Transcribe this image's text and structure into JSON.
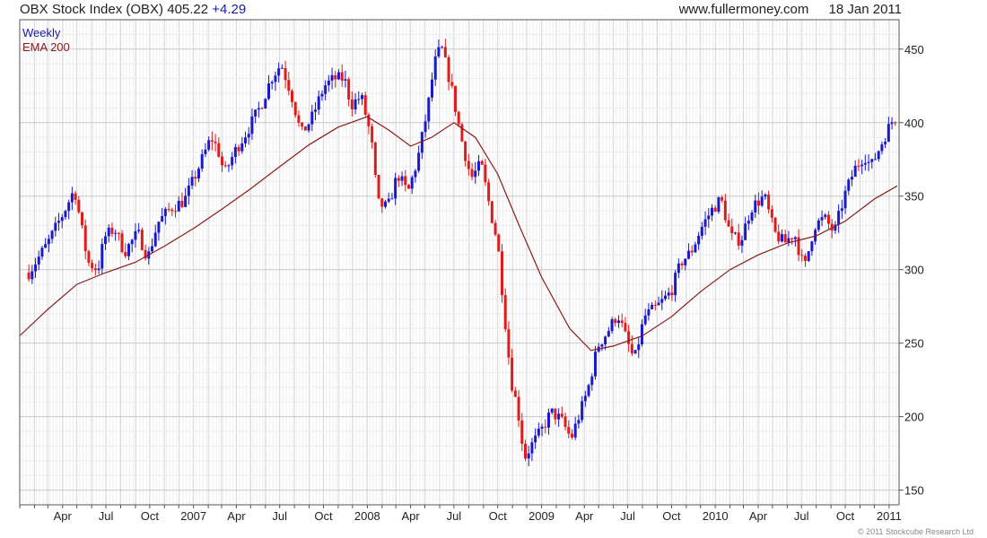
{
  "header": {
    "title": "OBX Stock Index (OBX) 405.22",
    "change": "+4.29",
    "site": "www.fullermoney.com",
    "date": "18 Jan 2011"
  },
  "legend": {
    "weekly": "Weekly",
    "ema": "EMA 200"
  },
  "copyright": "© 2011 Stockcube Research Ltd",
  "colors": {
    "up": "#1a1acc",
    "down": "#e01b1b",
    "ema": "#8b1a1a",
    "grid": "#d7d7d7",
    "axis": "#555555",
    "background": "#ffffff"
  },
  "chart_data": {
    "type": "candlestick-weekly",
    "ylim": [
      140,
      470
    ],
    "y_ticks": [
      150,
      200,
      250,
      300,
      350,
      400,
      450
    ],
    "x_ticks": [
      {
        "label": "Apr",
        "date": "2006-04-01"
      },
      {
        "label": "Jul",
        "date": "2006-07-01"
      },
      {
        "label": "Oct",
        "date": "2006-10-01"
      },
      {
        "label": "2007",
        "date": "2007-01-01"
      },
      {
        "label": "Apr",
        "date": "2007-04-01"
      },
      {
        "label": "Jul",
        "date": "2007-07-01"
      },
      {
        "label": "Oct",
        "date": "2007-10-01"
      },
      {
        "label": "2008",
        "date": "2008-01-01"
      },
      {
        "label": "Apr",
        "date": "2008-04-01"
      },
      {
        "label": "Jul",
        "date": "2008-07-01"
      },
      {
        "label": "Oct",
        "date": "2008-10-01"
      },
      {
        "label": "2009",
        "date": "2009-01-01"
      },
      {
        "label": "Apr",
        "date": "2009-04-01"
      },
      {
        "label": "Jul",
        "date": "2009-07-01"
      },
      {
        "label": "Oct",
        "date": "2009-10-01"
      },
      {
        "label": "2010",
        "date": "2010-01-01"
      },
      {
        "label": "Apr",
        "date": "2010-04-01"
      },
      {
        "label": "Jul",
        "date": "2010-07-01"
      },
      {
        "label": "Oct",
        "date": "2010-10-01"
      },
      {
        "label": "2011",
        "date": "2011-01-01"
      }
    ],
    "series": [
      {
        "name": "Weekly",
        "type": "candlestick",
        "close_keypoints": [
          [
            "2006-01-20",
            298
          ],
          [
            "2006-03-01",
            318
          ],
          [
            "2006-04-05",
            340
          ],
          [
            "2006-04-26",
            355
          ],
          [
            "2006-05-10",
            330
          ],
          [
            "2006-05-24",
            305
          ],
          [
            "2006-06-14",
            300
          ],
          [
            "2006-06-28",
            322
          ],
          [
            "2006-07-19",
            328
          ],
          [
            "2006-08-09",
            312
          ],
          [
            "2006-09-06",
            325
          ],
          [
            "2006-09-27",
            308
          ],
          [
            "2006-10-18",
            332
          ],
          [
            "2006-11-15",
            342
          ],
          [
            "2006-12-13",
            347
          ],
          [
            "2007-01-10",
            368
          ],
          [
            "2007-02-07",
            390
          ],
          [
            "2007-02-21",
            382
          ],
          [
            "2007-03-07",
            365
          ],
          [
            "2007-03-28",
            380
          ],
          [
            "2007-04-25",
            395
          ],
          [
            "2007-05-23",
            412
          ],
          [
            "2007-06-13",
            430
          ],
          [
            "2007-07-04",
            440
          ],
          [
            "2007-07-25",
            420
          ],
          [
            "2007-08-15",
            392
          ],
          [
            "2007-09-05",
            402
          ],
          [
            "2007-10-03",
            425
          ],
          [
            "2007-10-24",
            430
          ],
          [
            "2007-11-14",
            430
          ],
          [
            "2007-11-28",
            412
          ],
          [
            "2007-12-19",
            418
          ],
          [
            "2008-01-09",
            390
          ],
          [
            "2008-01-23",
            345
          ],
          [
            "2008-02-13",
            342
          ],
          [
            "2008-03-05",
            365
          ],
          [
            "2008-03-26",
            352
          ],
          [
            "2008-04-16",
            375
          ],
          [
            "2008-05-07",
            410
          ],
          [
            "2008-05-21",
            440
          ],
          [
            "2008-06-04",
            452
          ],
          [
            "2008-06-25",
            425
          ],
          [
            "2008-07-16",
            390
          ],
          [
            "2008-08-06",
            362
          ],
          [
            "2008-08-27",
            372
          ],
          [
            "2008-09-17",
            338
          ],
          [
            "2008-10-01",
            318
          ],
          [
            "2008-10-15",
            270
          ],
          [
            "2008-10-29",
            225
          ],
          [
            "2008-11-12",
            205
          ],
          [
            "2008-11-26",
            172
          ],
          [
            "2008-12-10",
            180
          ],
          [
            "2008-12-31",
            190
          ],
          [
            "2009-01-21",
            203
          ],
          [
            "2009-02-11",
            198
          ],
          [
            "2009-03-04",
            185
          ],
          [
            "2009-03-18",
            198
          ],
          [
            "2009-04-08",
            218
          ],
          [
            "2009-04-29",
            248
          ],
          [
            "2009-05-20",
            258
          ],
          [
            "2009-06-10",
            270
          ],
          [
            "2009-07-01",
            250
          ],
          [
            "2009-07-15",
            238
          ],
          [
            "2009-08-05",
            268
          ],
          [
            "2009-09-02",
            275
          ],
          [
            "2009-09-30",
            285
          ],
          [
            "2009-10-21",
            305
          ],
          [
            "2009-11-11",
            312
          ],
          [
            "2009-12-02",
            328
          ],
          [
            "2009-12-23",
            340
          ],
          [
            "2010-01-13",
            348
          ],
          [
            "2010-02-03",
            322
          ],
          [
            "2010-02-24",
            320
          ],
          [
            "2010-03-17",
            342
          ],
          [
            "2010-04-14",
            350
          ],
          [
            "2010-05-05",
            325
          ],
          [
            "2010-05-26",
            318
          ],
          [
            "2010-06-16",
            325
          ],
          [
            "2010-07-07",
            300
          ],
          [
            "2010-07-28",
            330
          ],
          [
            "2010-08-18",
            335
          ],
          [
            "2010-09-08",
            325
          ],
          [
            "2010-09-29",
            350
          ],
          [
            "2010-10-20",
            368
          ],
          [
            "2010-11-10",
            378
          ],
          [
            "2010-11-24",
            370
          ],
          [
            "2010-12-15",
            385
          ],
          [
            "2011-01-05",
            400
          ],
          [
            "2011-01-18",
            405
          ]
        ]
      },
      {
        "name": "EMA 200",
        "type": "line",
        "points": [
          [
            "2006-01-01",
            255
          ],
          [
            "2006-03-01",
            273
          ],
          [
            "2006-05-01",
            290
          ],
          [
            "2006-07-01",
            298
          ],
          [
            "2006-09-01",
            305
          ],
          [
            "2006-11-01",
            316
          ],
          [
            "2007-01-01",
            328
          ],
          [
            "2007-03-01",
            341
          ],
          [
            "2007-05-01",
            355
          ],
          [
            "2007-07-01",
            370
          ],
          [
            "2007-09-01",
            385
          ],
          [
            "2007-11-01",
            397
          ],
          [
            "2008-01-01",
            404
          ],
          [
            "2008-02-15",
            395
          ],
          [
            "2008-04-01",
            384
          ],
          [
            "2008-05-15",
            390
          ],
          [
            "2008-07-01",
            400
          ],
          [
            "2008-08-15",
            390
          ],
          [
            "2008-10-01",
            365
          ],
          [
            "2008-11-15",
            330
          ],
          [
            "2009-01-01",
            295
          ],
          [
            "2009-03-01",
            260
          ],
          [
            "2009-04-15",
            245
          ],
          [
            "2009-06-01",
            248
          ],
          [
            "2009-08-01",
            255
          ],
          [
            "2009-10-01",
            268
          ],
          [
            "2009-12-01",
            285
          ],
          [
            "2010-02-01",
            300
          ],
          [
            "2010-04-01",
            310
          ],
          [
            "2010-06-01",
            318
          ],
          [
            "2010-08-01",
            323
          ],
          [
            "2010-10-01",
            333
          ],
          [
            "2010-12-01",
            348
          ],
          [
            "2011-01-18",
            357
          ]
        ]
      }
    ]
  }
}
